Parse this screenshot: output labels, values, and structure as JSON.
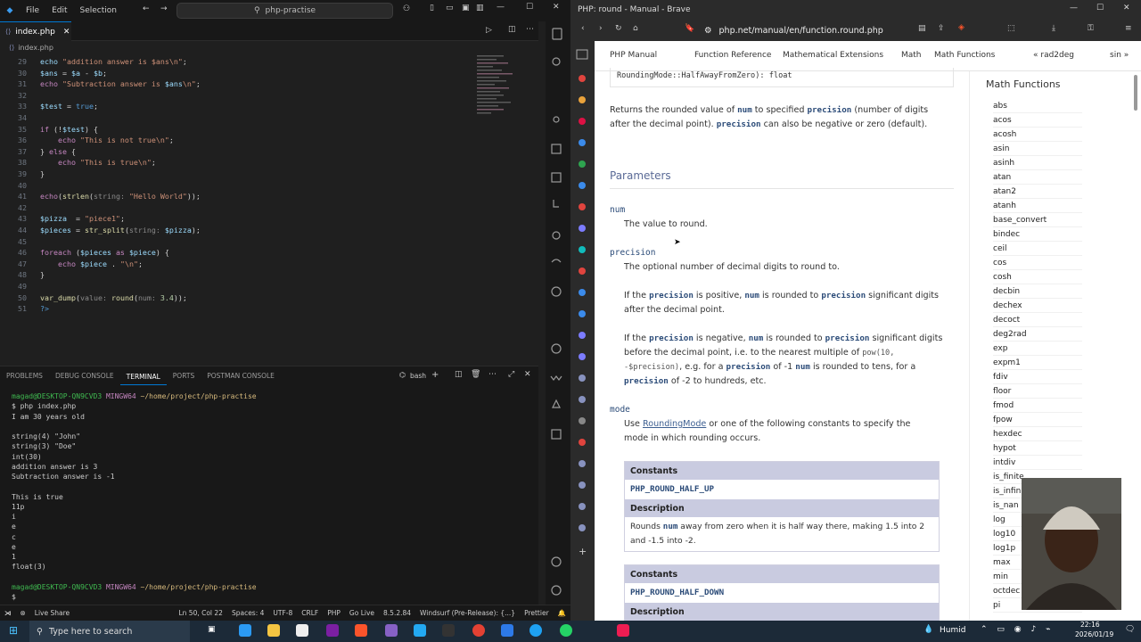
{
  "vscode": {
    "menu": [
      "File",
      "Edit",
      "Selection"
    ],
    "search": "php-practise",
    "tab": "index.php",
    "breadcrumb": "index.php",
    "lines": [
      {
        "n": "29",
        "html": "<span class='vr'>echo</span> <span class='st'>\"addition answer is $ans\\n\"</span>;"
      },
      {
        "n": "30",
        "html": "<span class='vr'>$ans</span> = <span class='vr'>$a</span> - <span class='vr'>$b</span>;"
      },
      {
        "n": "31",
        "html": "<span class='kw'>echo</span> <span class='st'>\"Subtraction answer is </span><span class='vr'>$ans</span><span class='st'>\\n\"</span>;"
      },
      {
        "n": "32",
        "html": ""
      },
      {
        "n": "33",
        "html": "<span class='vr'>$test</span> = <span class='bl'>true</span>;"
      },
      {
        "n": "34",
        "html": ""
      },
      {
        "n": "35",
        "html": "<span class='kw'>if</span> (!<span class='vr'>$test</span>) {"
      },
      {
        "n": "36",
        "html": "    <span class='kw'>echo</span> <span class='st'>\"This is not true\\n\"</span>;"
      },
      {
        "n": "37",
        "html": "} <span class='kw'>else</span> {"
      },
      {
        "n": "38",
        "html": "    <span class='kw'>echo</span> <span class='st'>\"This is true\\n\"</span>;"
      },
      {
        "n": "39",
        "html": "}"
      },
      {
        "n": "40",
        "html": ""
      },
      {
        "n": "41",
        "html": "<span class='kw'>echo</span>(<span class='fn'>strlen</span>(<span class='hint'>string:</span> <span class='st'>\"Hello World\"</span>));"
      },
      {
        "n": "42",
        "html": ""
      },
      {
        "n": "43",
        "html": "<span class='vr'>$pizza</span>  = <span class='st'>\"piece1\"</span>;"
      },
      {
        "n": "44",
        "html": "<span class='vr'>$pieces</span> = <span class='fn'>str_split</span>(<span class='hint'>string:</span> <span class='vr'>$pizza</span>);"
      },
      {
        "n": "45",
        "html": ""
      },
      {
        "n": "46",
        "html": "<span class='kw'>foreach</span> (<span class='vr'>$pieces</span> <span class='kw'>as</span> <span class='vr'>$piece</span>) {"
      },
      {
        "n": "47",
        "html": "    <span class='kw'>echo</span> <span class='vr'>$piece</span> . <span class='st'>\"\\n\"</span>;"
      },
      {
        "n": "48",
        "html": "}"
      },
      {
        "n": "49",
        "html": ""
      },
      {
        "n": "50",
        "html": "<span class='fn'>var_dump</span>(<span class='hint'>value:</span> <span class='fn'>round</span>(<span class='hint'>num:</span> <span class='num'>3.4</span>));"
      },
      {
        "n": "51",
        "html": "<span class='bl'>?></span>"
      }
    ],
    "panel_tabs": [
      "PROBLEMS",
      "DEBUG CONSOLE",
      "TERMINAL",
      "PORTS",
      "POSTMAN CONSOLE"
    ],
    "shell": "bash",
    "terminal_lines": [
      {
        "html": "<span class='tg'>magad@DESKTOP-QN9CVD3</span> <span class='tp'>MINGW64</span> <span class='ty'>~/home/project/php-practise</span>"
      },
      {
        "html": "$ php index.php"
      },
      {
        "html": "I am 30 years old"
      },
      {
        "html": ""
      },
      {
        "html": "string(4) \"John\""
      },
      {
        "html": "string(3) \"Doe\""
      },
      {
        "html": "int(30)"
      },
      {
        "html": "addition answer is 3"
      },
      {
        "html": "Subtraction answer is -1"
      },
      {
        "html": ""
      },
      {
        "html": "This is true"
      },
      {
        "html": "11p"
      },
      {
        "html": "i"
      },
      {
        "html": "e"
      },
      {
        "html": "c"
      },
      {
        "html": "e"
      },
      {
        "html": "1"
      },
      {
        "html": "float(3)"
      },
      {
        "html": ""
      },
      {
        "html": "<span class='tg'>magad@DESKTOP-QN9CVD3</span> <span class='tp'>MINGW64</span> <span class='ty'>~/home/project/php-practise</span>"
      },
      {
        "html": "$ "
      }
    ],
    "status": {
      "live_share": "Live Share",
      "position": "Ln 50, Col 22",
      "spaces": "Spaces: 4",
      "encoding": "UTF-8",
      "eol": "CRLF",
      "lang": "PHP",
      "go_live": "Go Live",
      "version": "8.5.2.84",
      "windsurf": "Windsurf (Pre-Release): {...}",
      "prettier": "Prettier"
    }
  },
  "browser": {
    "title": "PHP: round - Manual - Brave",
    "url": "php.net/manual/en/function.round.php",
    "nav": [
      "PHP Manual",
      "Function Reference",
      "Mathematical Extensions",
      "Math",
      "Math Functions"
    ],
    "nav_prev": "« rad2deg",
    "nav_next": "sin »",
    "signature_tail": "RoundingMode::HalfAwayFromZero): float",
    "returns_text": {
      "p1": "Returns the rounded value of ",
      "p2": " to specified ",
      "p3": " (number of digits after the decimal point). ",
      "p4": " can also be negative or zero (default).",
      "num": "num",
      "precision": "precision"
    },
    "parameters_heading": "Parameters",
    "param_num": "num",
    "param_num_desc": "The value to round.",
    "param_precision": "precision",
    "param_precision_desc": "The optional number of decimal digits to round to.",
    "positive_text": {
      "a": "If the ",
      "b": " is positive, ",
      "c": " is rounded to ",
      "d": " significant digits after the decimal point."
    },
    "negative_text": {
      "a": "If the ",
      "b": " is negative, ",
      "c": " is rounded to ",
      "d": " significant digits before the decimal point, i.e. to the nearest multiple of ",
      "pow": "pow(10, -$precision)",
      "e": ", e.g. for a ",
      "f": " of -1 ",
      "g": " is rounded to tens, for a ",
      "h": " of -2 to hundreds, etc."
    },
    "param_mode": "mode",
    "mode_text": {
      "a": "Use ",
      "link": "RoundingMode",
      "b": " or one of the following constants to specify the mode in which rounding occurs."
    },
    "constants_label": "Constants",
    "description_label": "Description",
    "const1": "PHP_ROUND_HALF_UP",
    "const1_desc": {
      "a": "Rounds ",
      "b": " away from zero when it is half way there, making 1.5 into 2 and -1.5 into -2."
    },
    "const2": "PHP_ROUND_HALF_DOWN",
    "sidebar_heading": "Math Functions",
    "sidebar_items": [
      "abs",
      "acos",
      "acosh",
      "asin",
      "asinh",
      "atan",
      "atan2",
      "atanh",
      "base_convert",
      "bindec",
      "ceil",
      "cos",
      "cosh",
      "decbin",
      "dechex",
      "decoct",
      "deg2rad",
      "exp",
      "expm1",
      "fdiv",
      "floor",
      "fmod",
      "fpow",
      "hexdec",
      "hypot",
      "intdiv",
      "is_finite",
      "is_infinite",
      "is_nan",
      "log",
      "log10",
      "log1p",
      "max",
      "min",
      "octdec",
      "pi"
    ]
  },
  "taskbar": {
    "search_placeholder": "Type here to search",
    "weather": "Humid",
    "time": "22:16",
    "date": "2026/01/19"
  }
}
